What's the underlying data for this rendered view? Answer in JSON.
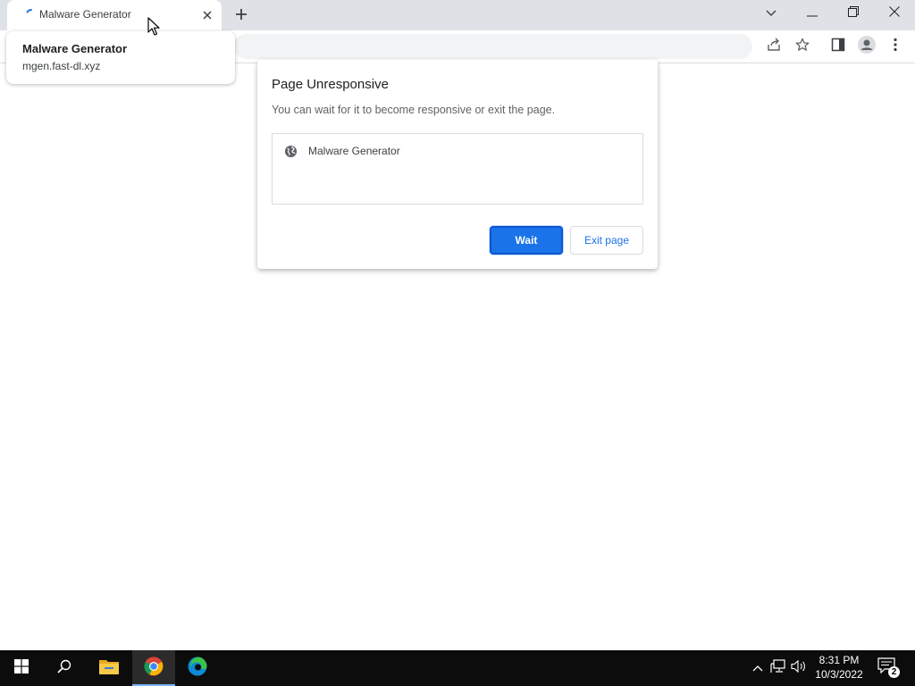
{
  "browser": {
    "tab": {
      "title": "Malware Generator",
      "loading": true,
      "close_icon": "close-icon"
    },
    "new_tab_icon": "plus-icon",
    "window_controls": [
      "chevron-down-icon",
      "minimize-icon",
      "restore-icon",
      "close-icon"
    ],
    "toolbar_icons": [
      "share-icon",
      "star-icon",
      "side-panel-icon",
      "profile-icon",
      "more-vert-icon"
    ],
    "accent_color": "#1a73e8"
  },
  "hover_card": {
    "title": "Malware Generator",
    "url": "mgen.fast-dl.xyz"
  },
  "dialog": {
    "title": "Page Unresponsive",
    "message": "You can wait for it to become responsive or exit the page.",
    "pages": [
      {
        "icon": "globe-icon",
        "name": "Malware Generator"
      }
    ],
    "wait_label": "Wait",
    "exit_label": "Exit page"
  },
  "taskbar": {
    "apps": [
      "windows-start-icon",
      "search-icon",
      "file-explorer-icon",
      "chrome-icon",
      "edge-icon"
    ],
    "active_app": "chrome-icon",
    "tray_icons": [
      "chevron-up-icon",
      "network-icon",
      "volume-icon"
    ],
    "time": "8:31 PM",
    "date": "10/3/2022",
    "notification_count": "2"
  }
}
